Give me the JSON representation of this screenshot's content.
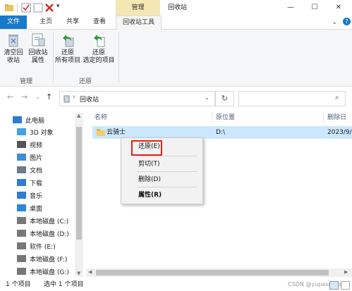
{
  "titlebar": {
    "manage_tab": "管理",
    "window_title": "回收站",
    "minimize": "—",
    "maximize": "☐",
    "close": "✕",
    "help": "?"
  },
  "ribbon_tabs": {
    "file": "文件",
    "home": "主页",
    "share": "共享",
    "view": "查看",
    "recycle_tools": "回收站工具"
  },
  "ribbon": {
    "empty_bin": [
      "清空回",
      "收站"
    ],
    "bin_props": [
      "回收站",
      "属性"
    ],
    "group_manage": "管理",
    "restore_all": [
      "还原",
      "所有项目"
    ],
    "restore_selected": [
      "还原",
      "选定的项目"
    ],
    "group_restore": "还原"
  },
  "address": {
    "path": "回收站",
    "search_placeholder": ""
  },
  "nav": {
    "items": [
      {
        "label": "此电脑",
        "icon": "pc-icon",
        "color": "#2b7cd3"
      },
      {
        "label": "3D 对象",
        "icon": "3d-objects-icon",
        "color": "#41a3e0"
      },
      {
        "label": "视频",
        "icon": "video-icon",
        "color": "#555555"
      },
      {
        "label": "图片",
        "icon": "pictures-icon",
        "color": "#3d8ed6"
      },
      {
        "label": "文档",
        "icon": "documents-icon",
        "color": "#6e7b8a"
      },
      {
        "label": "下载",
        "icon": "download-icon",
        "color": "#2b7cd3"
      },
      {
        "label": "音乐",
        "icon": "music-icon",
        "color": "#2b7cd3"
      },
      {
        "label": "桌面",
        "icon": "desktop-icon",
        "color": "#2b88d8"
      },
      {
        "label": "本地磁盘 (C:)",
        "icon": "drive-icon",
        "color": "#777777"
      },
      {
        "label": "本地磁盘 (D:)",
        "icon": "drive-icon",
        "color": "#777777"
      },
      {
        "label": "软件 (E:)",
        "icon": "drive-icon",
        "color": "#777777"
      },
      {
        "label": "本地磁盘 (F:)",
        "icon": "drive-icon",
        "color": "#777777"
      },
      {
        "label": "本地磁盘 (G:)",
        "icon": "drive-icon",
        "color": "#777777"
      }
    ]
  },
  "columns": {
    "name": "名称",
    "original_location": "原位置",
    "date_deleted": "删除日"
  },
  "file_row": {
    "name": "云骑士",
    "location": "D:\\",
    "date": "2023/9/"
  },
  "context_menu": {
    "restore": "还原(E)",
    "cut": "剪切(T)",
    "delete": "删除(D)",
    "properties": "属性(R)"
  },
  "status": {
    "count": "1 个项目",
    "selected": "选中 1 个项目",
    "watermark": "CSDN @yupasmole"
  },
  "colors": {
    "accent": "#1979ca",
    "manage_tab": "#f3e7b3",
    "selection": "#cce8ff",
    "highlight_box": "#e2231a"
  }
}
